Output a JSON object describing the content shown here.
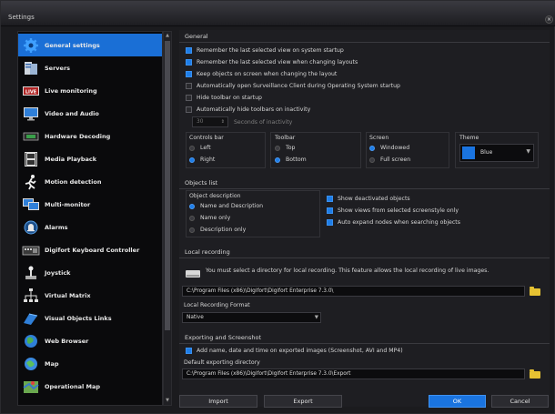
{
  "window": {
    "title": "Settings",
    "close": "×"
  },
  "sidebar": {
    "items": [
      {
        "label": "General settings",
        "icon": "gear-icon",
        "selected": true
      },
      {
        "label": "Servers",
        "icon": "server-icon"
      },
      {
        "label": "Live monitoring",
        "icon": "live-monitoring-icon"
      },
      {
        "label": "Video and Audio",
        "icon": "monitor-icon"
      },
      {
        "label": "Hardware Decoding",
        "icon": "chip-icon"
      },
      {
        "label": "Media Playback",
        "icon": "film-icon"
      },
      {
        "label": "Motion detection",
        "icon": "running-person-icon"
      },
      {
        "label": "Multi-monitor",
        "icon": "multi-monitor-icon"
      },
      {
        "label": "Alarms",
        "icon": "alarm-icon"
      },
      {
        "label": "Digifort Keyboard Controller",
        "icon": "keyboard-icon"
      },
      {
        "label": "Joystick",
        "icon": "joystick-icon"
      },
      {
        "label": "Virtual Matrix",
        "icon": "matrix-icon"
      },
      {
        "label": "Visual Objects Links",
        "icon": "link-icon"
      },
      {
        "label": "Web Browser",
        "icon": "globe-icon"
      },
      {
        "label": "Map",
        "icon": "map-icon"
      },
      {
        "label": "Operational Map",
        "icon": "operational-map-icon"
      }
    ]
  },
  "general": {
    "title": "General",
    "options": [
      {
        "label": "Remember the last selected view on system startup",
        "checked": true
      },
      {
        "label": "Remember the last selected view when changing layouts",
        "checked": true
      },
      {
        "label": "Keep objects on screen when changing the layout",
        "checked": true
      },
      {
        "label": "Automatically open Surveillance Client during Operating System startup",
        "checked": false
      },
      {
        "label": "Hide toolbar on startup",
        "checked": false
      },
      {
        "label": "Automatically hide toolbars on inactivity",
        "checked": false
      }
    ],
    "inactivity_value": "30",
    "inactivity_unit": "Seconds of inactivity",
    "controls_bar": {
      "title": "Controls bar",
      "options": [
        "Left",
        "Right"
      ],
      "selected": "Right"
    },
    "toolbar": {
      "title": "Toolbar",
      "options": [
        "Top",
        "Bottom"
      ],
      "selected": "Bottom"
    },
    "screen": {
      "title": "Screen",
      "options": [
        "Windowed",
        "Full screen"
      ],
      "selected": "Windowed"
    },
    "theme": {
      "title": "Theme",
      "value": "Blue",
      "swatch": "#1a74e0"
    }
  },
  "objects_list": {
    "title": "Objects list",
    "description_title": "Object description",
    "description_options": [
      "Name and Description",
      "Name only",
      "Description only"
    ],
    "description_selected": "Name and Description",
    "options": [
      {
        "label": "Show deactivated objects",
        "checked": true
      },
      {
        "label": "Show views from selected screenstyle only",
        "checked": true
      },
      {
        "label": "Auto expand nodes when searching objects",
        "checked": true
      }
    ]
  },
  "local_recording": {
    "title": "Local recording",
    "message": "You must select a directory for local recording. This feature allows the local recording of live images.",
    "path": "C:\\Program Files (x86)\\Digifort\\Digifort Enterprise 7.3.0\\",
    "format_label": "Local Recording Format",
    "format_value": "Native"
  },
  "export": {
    "title": "Exporting and Screenshot",
    "option": {
      "label": "Add name, date and time on exported images (Screenshot, AVI and MP4)",
      "checked": true
    },
    "dir_label": "Default exporting directory",
    "dir_path": "C:\\Program Files (x86)\\Digifort\\Digifort Enterprise 7.3.0\\Export"
  },
  "buttons": {
    "import": "Import",
    "export": "Export",
    "ok": "OK",
    "cancel": "Cancel"
  },
  "colors": {
    "accent": "#1a74e0",
    "background": "#1e1e22",
    "folder": "#e6c232"
  }
}
